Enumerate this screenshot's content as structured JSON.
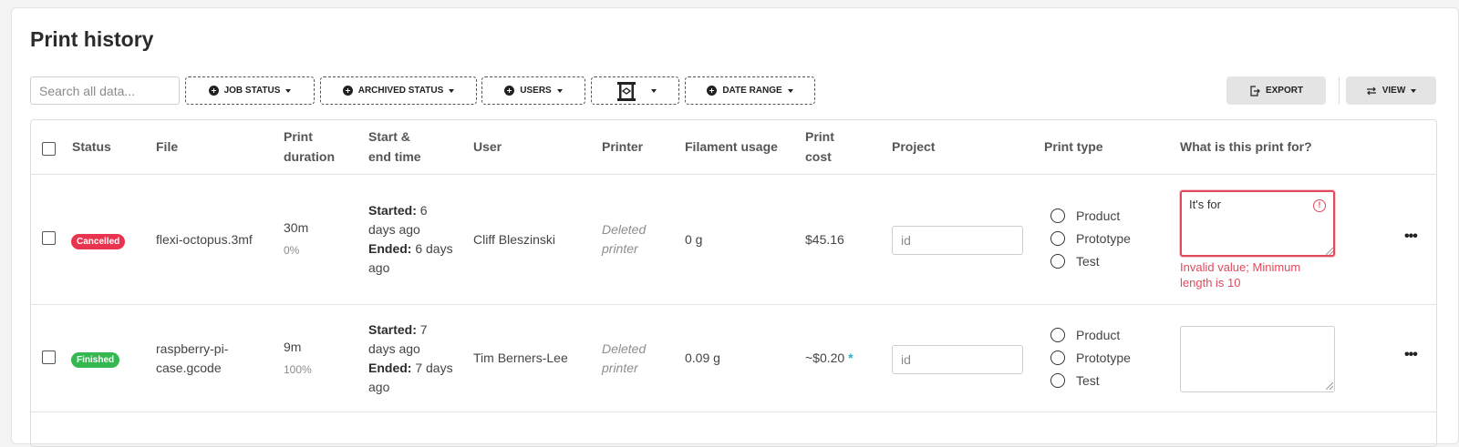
{
  "page": {
    "title": "Print history"
  },
  "toolbar": {
    "search_placeholder": "Search all data...",
    "filters": {
      "job_status": "JOB STATUS",
      "archived_status": "ARCHIVED STATUS",
      "users": "USERS",
      "date_range": "DATE RANGE"
    },
    "export_label": "EXPORT",
    "view_label": "VIEW"
  },
  "table": {
    "headers": {
      "status": "Status",
      "file": "File",
      "duration_1": "Print",
      "duration_2": "duration",
      "time_1": "Start &",
      "time_2": "end time",
      "user": "User",
      "printer": "Printer",
      "filament": "Filament usage",
      "cost_1": "Print",
      "cost_2": "cost",
      "project": "Project",
      "print_type": "Print type",
      "purpose": "What is this print for?"
    },
    "rows": [
      {
        "status": "Cancelled",
        "status_color": "#e8344e",
        "file": "flexi-octopus.3mf",
        "file_2": "",
        "duration": "30m",
        "progress": "0%",
        "started_label": "Started:",
        "started_1": " 6",
        "started_2": "days ago",
        "ended_label": "Ended:",
        "ended_1": " 6 days",
        "ended_2": "ago",
        "user": "Cliff Bleszinski",
        "printer_1": "Deleted",
        "printer_2": "printer",
        "filament": "0 g",
        "cost": "$45.16",
        "cost_note": "",
        "project_placeholder": "id",
        "print_types": [
          "Product",
          "Prototype",
          "Test"
        ],
        "purpose_value": "It's for",
        "error_1": "Invalid value; Minimum",
        "error_2": "length is 10"
      },
      {
        "status": "Finished",
        "status_color": "#34b84f",
        "file": "raspberry-pi-",
        "file_2": "case.gcode",
        "duration": "9m",
        "progress": "100%",
        "started_label": "Started:",
        "started_1": " 7",
        "started_2": "days ago",
        "ended_label": "Ended:",
        "ended_1": " 7 days",
        "ended_2": "ago",
        "user": "Tim Berners-Lee",
        "printer_1": "Deleted",
        "printer_2": "printer",
        "filament": "0.09 g",
        "cost": "~$0.20",
        "cost_note": "*",
        "project_placeholder": "id",
        "print_types": [
          "Product",
          "Prototype",
          "Test"
        ],
        "purpose_value": ""
      }
    ]
  }
}
